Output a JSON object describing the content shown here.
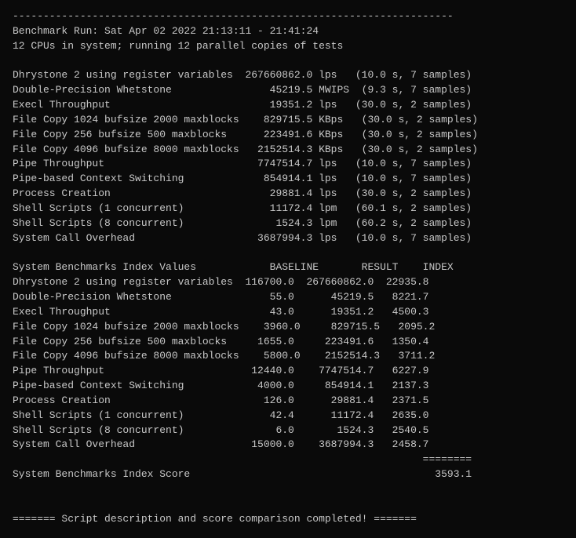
{
  "separator": "------------------------------------------------------------------------",
  "header": {
    "benchmark_run": "Benchmark Run: Sat Apr 02 2022 21:13:11 - 21:41:24",
    "cpu_info": "12 CPUs in system; running 12 parallel copies of tests"
  },
  "benchmarks": [
    {
      "label": "Dhrystone 2 using register variables",
      "value": "267660862.0",
      "unit": "lps",
      "extra": " (10.0 s, 7 samples)"
    },
    {
      "label": "Double-Precision Whetstone",
      "value": "45219.5",
      "unit": "MWIPS",
      "extra": "(9.3 s, 7 samples)"
    },
    {
      "label": "Execl Throughput",
      "value": "19351.2",
      "unit": "lps",
      "extra": " (30.0 s, 2 samples)"
    },
    {
      "label": "File Copy 1024 bufsize 2000 maxblocks",
      "value": "829715.5",
      "unit": "KBps",
      "extra": "(30.0 s, 2 samples)"
    },
    {
      "label": "File Copy 256 bufsize 500 maxblocks",
      "value": "223491.6",
      "unit": "KBps",
      "extra": "(30.0 s, 2 samples)"
    },
    {
      "label": "File Copy 4096 bufsize 8000 maxblocks",
      "value": "2152514.3",
      "unit": "KBps",
      "extra": "(30.0 s, 2 samples)"
    },
    {
      "label": "Pipe Throughput",
      "value": "7747514.7",
      "unit": "lps",
      "extra": " (10.0 s, 7 samples)"
    },
    {
      "label": "Pipe-based Context Switching",
      "value": "854914.1",
      "unit": "lps",
      "extra": " (10.0 s, 7 samples)"
    },
    {
      "label": "Process Creation",
      "value": "29881.4",
      "unit": "lps",
      "extra": " (30.0 s, 2 samples)"
    },
    {
      "label": "Shell Scripts (1 concurrent)",
      "value": "11172.4",
      "unit": "lpm",
      "extra": " (60.1 s, 2 samples)"
    },
    {
      "label": "Shell Scripts (8 concurrent)",
      "value": "1524.3",
      "unit": "lpm",
      "extra": " (60.2 s, 2 samples)"
    },
    {
      "label": "System Call Overhead",
      "value": "3687994.3",
      "unit": "lps",
      "extra": " (10.0 s, 7 samples)"
    }
  ],
  "index_header": "System Benchmarks Index Values         BASELINE       RESULT    INDEX",
  "index_rows": [
    {
      "label": "Dhrystone 2 using register variables",
      "baseline": "116700.0",
      "result": "267660862.0",
      "index": "22935.8"
    },
    {
      "label": "Double-Precision Whetstone",
      "baseline": "55.0",
      "result": "45219.5",
      "index": "8221.7"
    },
    {
      "label": "Execl Throughput",
      "baseline": "43.0",
      "result": "19351.2",
      "index": "4500.3"
    },
    {
      "label": "File Copy 1024 bufsize 2000 maxblocks",
      "baseline": "3960.0",
      "result": "829715.5",
      "index": "2095.2"
    },
    {
      "label": "File Copy 256 bufsize 500 maxblocks",
      "baseline": "1655.0",
      "result": "223491.6",
      "index": "1350.4"
    },
    {
      "label": "File Copy 4096 bufsize 8000 maxblocks",
      "baseline": "5800.0",
      "result": "2152514.3",
      "index": "3711.2"
    },
    {
      "label": "Pipe Throughput",
      "baseline": "12440.0",
      "result": "7747514.7",
      "index": "6227.9"
    },
    {
      "label": "Pipe-based Context Switching",
      "baseline": "4000.0",
      "result": "854914.1",
      "index": "2137.3"
    },
    {
      "label": "Process Creation",
      "baseline": "126.0",
      "result": "29881.4",
      "index": "2371.5"
    },
    {
      "label": "Shell Scripts (1 concurrent)",
      "baseline": "42.4",
      "result": "11172.4",
      "index": "2635.0"
    },
    {
      "label": "Shell Scripts (8 concurrent)",
      "baseline": "6.0",
      "result": "1524.3",
      "index": "2540.5"
    },
    {
      "label": "System Call Overhead",
      "baseline": "15000.0",
      "result": "3687994.3",
      "index": "2458.7"
    }
  ],
  "equals_bar": "========",
  "score_label": "System Benchmarks Index Score",
  "score_value": "3593.1",
  "completion": "======= Script description and score comparison completed! ======="
}
